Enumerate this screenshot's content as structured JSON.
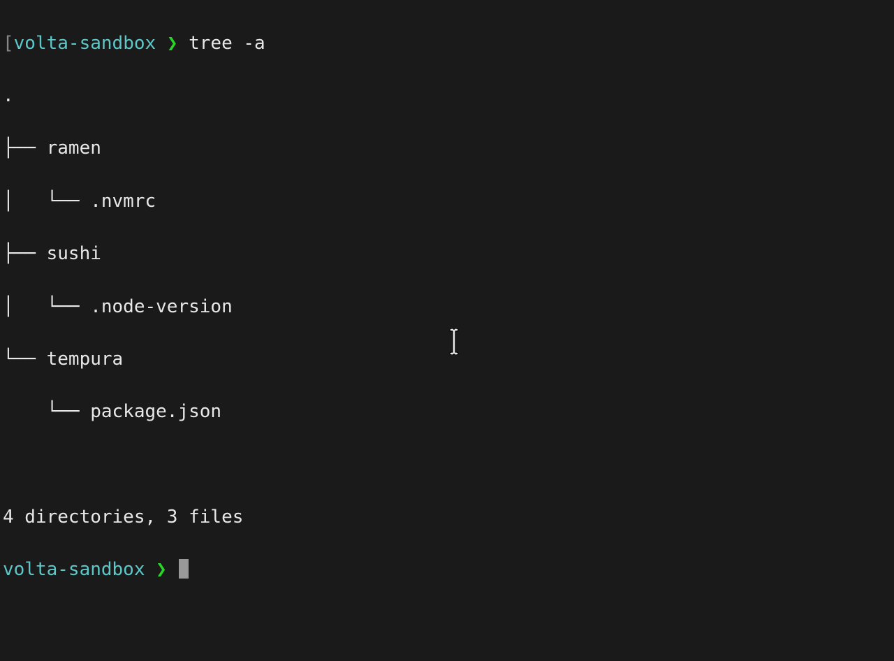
{
  "prompt1": {
    "bracket_open": "[",
    "dir": "volta-sandbox",
    "symbol": "❯",
    "command": "tree -a"
  },
  "tree": {
    "root": ".",
    "line1": "├── ramen",
    "line2": "│   └── .nvmrc",
    "line3": "├── sushi",
    "line4": "│   └── .node-version",
    "line5": "└── tempura",
    "line6": "    └── package.json"
  },
  "summary": "4 directories, 3 files",
  "prompt2": {
    "dir": "volta-sandbox",
    "symbol": "❯"
  }
}
